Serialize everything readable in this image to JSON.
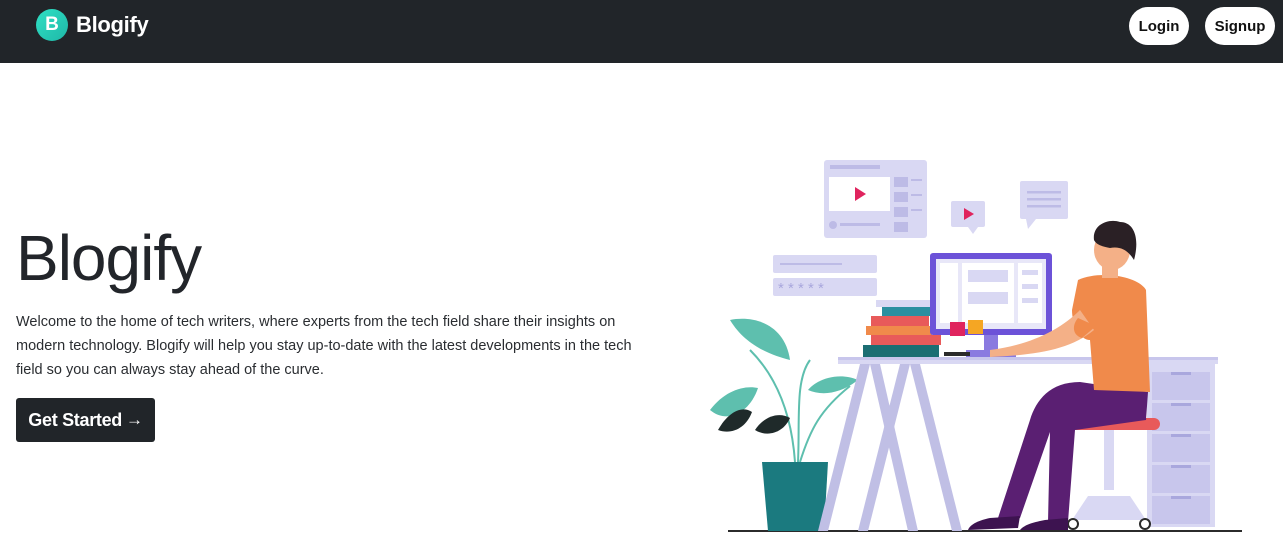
{
  "navbar": {
    "brand_initial": "B",
    "brand_name": "Blogify",
    "login_label": "Login",
    "signup_label": "Signup"
  },
  "hero": {
    "title": "Blogify",
    "description": "Welcome to the home of tech writers, where experts from the tech field share their insights on modern technology. Blogify will help you stay up-to-date with the latest developments in the tech field so you can always stay ahead of the curve.",
    "cta_label": "Get Started",
    "cta_arrow": "→"
  },
  "illustration": {
    "password_mask": "* * * * *"
  },
  "colors": {
    "navbar_bg": "#212529",
    "accent_teal": "#2fe0c4",
    "button_dark": "#212529",
    "illustration_lavender": "#d9d8f3",
    "shirt_orange": "#f08a4b",
    "pants_purple": "#5a1f72",
    "play_red": "#e0245e"
  },
  "icons": [
    "brand-logo-icon",
    "arrow-right-icon",
    "play-icon"
  ]
}
